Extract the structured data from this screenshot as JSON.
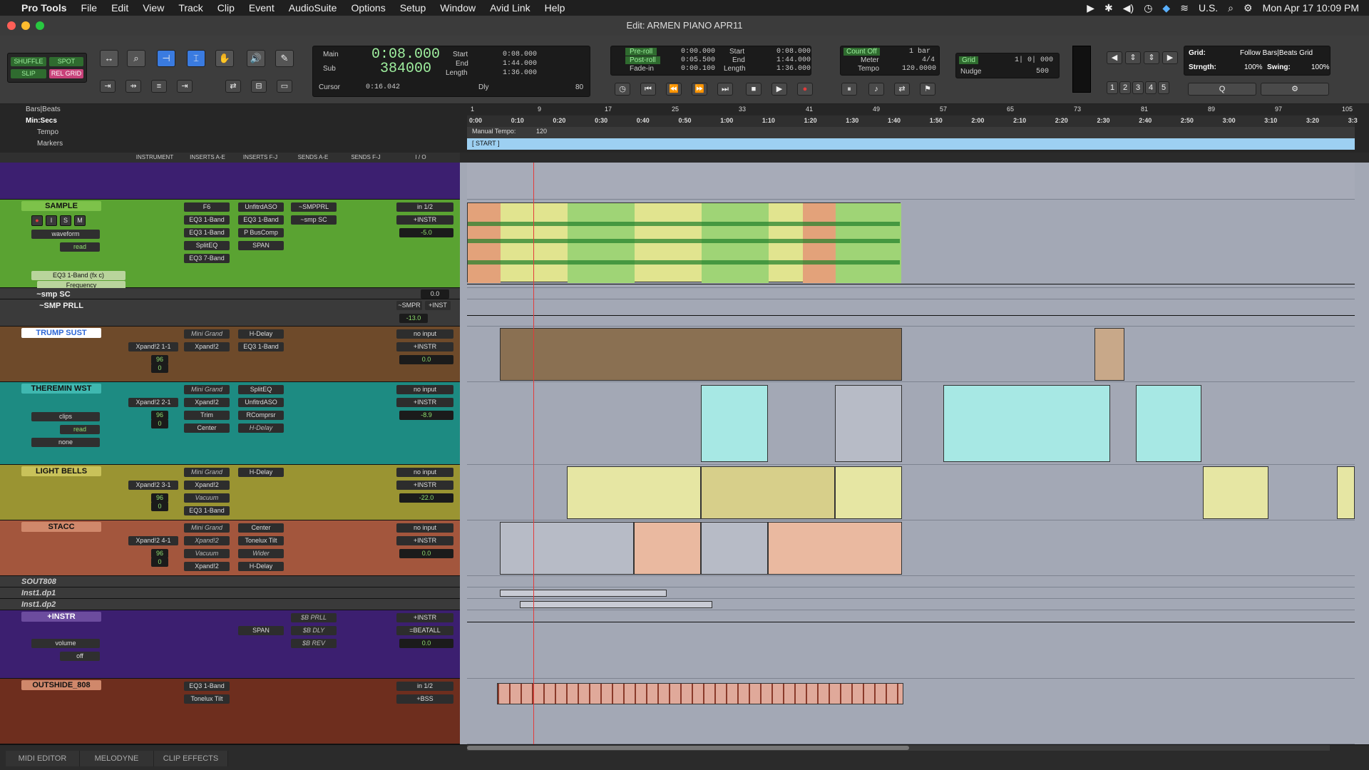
{
  "menubar": {
    "app": "Pro Tools",
    "items": [
      "File",
      "Edit",
      "View",
      "Track",
      "Clip",
      "Event",
      "AudioSuite",
      "Options",
      "Setup",
      "Window",
      "Avid Link",
      "Help"
    ],
    "input_source": "U.S.",
    "datetime": "Mon Apr 17  10:09 PM"
  },
  "window": {
    "title": "Edit: ARMEN PIANO APR11"
  },
  "modes": {
    "shuffle": "SHUFFLE",
    "spot": "SPOT",
    "slip": "SLIP",
    "relgrid": "REL GRID"
  },
  "counters": {
    "main_label": "Main",
    "main_value": "0:08.000",
    "sub_label": "Sub",
    "sub_value": "384000",
    "start_label": "Start",
    "start_value": "0:08.000",
    "end_label": "End",
    "end_value": "1:44.000",
    "length_label": "Length",
    "length_value": "1:36.000",
    "cursor_label": "Cursor",
    "cursor_value": "0:16.042",
    "dly": "Dly",
    "dly_value": "80"
  },
  "transport": {
    "preroll_label": "Pre-roll",
    "preroll_value": "0:00.000",
    "postroll_label": "Post-roll",
    "postroll_value": "0:05.500",
    "fadein_label": "Fade-in",
    "fadein_value": "0:00.100",
    "start_label": "Start",
    "start_value": "0:08.000",
    "end_label": "End",
    "end_value": "1:44.000",
    "length_label": "Length",
    "length_value": "1:36.000"
  },
  "midi": {
    "countoff": "Count Off",
    "countoff_value": "1 bar",
    "meter_label": "Meter",
    "meter_value": "4/4",
    "tempo_label": "Tempo",
    "tempo_value": "120.0000"
  },
  "grid": {
    "grid_label": "Grid",
    "grid_value": "1| 0| 000",
    "nudge_label": "Nudge",
    "nudge_value": "500",
    "grid2_label": "Grid:",
    "grid2_value": "Follow Bars|Beats Grid",
    "strength_label": "Strngth:",
    "strength_value": "100%",
    "swing_label": "Swing:",
    "swing_value": "100%"
  },
  "zoom_presets": [
    "1",
    "2",
    "3",
    "4",
    "5"
  ],
  "rulers": {
    "barsbeats": "Bars|Beats",
    "minsecs": "Min:Secs",
    "tempo": "Tempo",
    "markers": "Markers",
    "manual_tempo": "Manual Tempo:",
    "tempo_val": "120",
    "start_marker": "[ START ]",
    "bar_ticks": [
      "1",
      "9",
      "17",
      "25",
      "33",
      "41",
      "49",
      "57",
      "65",
      "73",
      "81",
      "89",
      "97",
      "105"
    ],
    "sec_ticks": [
      "0:00",
      "0:10",
      "0:20",
      "0:30",
      "0:40",
      "0:50",
      "1:00",
      "1:10",
      "1:20",
      "1:30",
      "1:40",
      "1:50",
      "2:00",
      "2:10",
      "2:20",
      "2:30",
      "2:40",
      "2:50",
      "3:00",
      "3:10",
      "3:20",
      "3:3"
    ]
  },
  "columns": [
    "INSTRUMENT",
    "INSERTS A-E",
    "INSERTS F-J",
    "SENDS A-E",
    "SENDS F-J",
    "I / O"
  ],
  "tracks": [
    {
      "name": "SAMPLE",
      "color": "#7dc24a",
      "view": "waveform",
      "auto": "read",
      "in": "in 1/2",
      "out": "+INSTR",
      "vol": "-5.0",
      "ins": [
        "F6",
        "EQ3 1-Band",
        "EQ3 1-Band",
        "SplitEQ",
        "EQ3 7-Band"
      ],
      "ins2": [
        "UnfitrdASO",
        "EQ3 1-Band",
        "P BusComp",
        "SPAN",
        ""
      ],
      "sends": [
        "~SMPPRL",
        "~smp SC",
        "",
        "",
        ""
      ],
      "lane": "EQ3 1-Band (fx c)",
      "param": "Frequency"
    },
    {
      "name": "~smp SC",
      "color": "#555",
      "vol": "0.0"
    },
    {
      "name": "~SMP PRLL",
      "color": "#555",
      "in": "~SMPR",
      "out": "+INST",
      "vol": "-13.0"
    },
    {
      "name": "TRUMP SUST",
      "color": "#b88a5c",
      "inst": "Xpand!2 1-1",
      "ins": [
        "Mini Grand",
        "Xpand!2",
        "",
        "",
        ""
      ],
      "ins2": [
        "H-Delay",
        "EQ3 1-Band",
        "",
        "",
        ""
      ],
      "in": "no input",
      "out": "+INSTR",
      "vol": "0.0",
      "mvol": "96",
      "pan": "0"
    },
    {
      "name": "THEREMIN WST",
      "color": "#3fb8b0",
      "inst": "Xpand!2 2-1",
      "ins": [
        "Mini Grand",
        "Xpand!2",
        "Trim",
        "Center",
        ""
      ],
      "ins2": [
        "SplitEQ",
        "UnfitrdASO",
        "RComprsr",
        "H-Delay",
        ""
      ],
      "in": "no input",
      "out": "+INSTR",
      "vol": "-8.9",
      "mvol": "96",
      "pan": "0",
      "view": "clips",
      "auto": "read",
      "extra": "none"
    },
    {
      "name": "LIGHT BELLS",
      "color": "#c9c25a",
      "inst": "Xpand!2 3-1",
      "ins": [
        "Mini Grand",
        "Xpand!2",
        "Vacuum",
        "EQ3 1-Band",
        ""
      ],
      "ins2": [
        "H-Delay",
        "",
        "",
        "",
        ""
      ],
      "in": "no input",
      "out": "+INSTR",
      "vol": "-22.0",
      "mvol": "96",
      "pan": "0"
    },
    {
      "name": "STACC",
      "color": "#d0886b",
      "inst": "Xpand!2 4-1",
      "ins": [
        "Mini Grand",
        "Xpand!2",
        "Vacuum",
        "Xpand!2",
        ""
      ],
      "ins2": [
        "Center",
        "Tonelux Tilt",
        "Wider",
        "H-Delay",
        ""
      ],
      "in": "no input",
      "out": "+INSTR",
      "vol": "0.0",
      "mvol": "96",
      "pan": "0"
    },
    {
      "name": "SOUT808",
      "color": "#555"
    },
    {
      "name": "Inst1.dp1",
      "color": "#555"
    },
    {
      "name": "Inst1.dp2",
      "color": "#555"
    },
    {
      "name": "+INSTR",
      "color": "#6c4c9e",
      "ins2": [
        "",
        "SPAN",
        "",
        "",
        ""
      ],
      "sends": [
        "$B PRLL",
        "$B DLY",
        "$B REV",
        "",
        ""
      ],
      "in": "+INSTR",
      "out": "=BEATALL",
      "vol": "0.0",
      "view": "volume",
      "auto": "off"
    },
    {
      "name": "OUTSHIDE_808",
      "color": "#d0886b",
      "ins": [
        "EQ3 1-Band",
        "Tonelux Tilt"
      ],
      "in": "in 1/2",
      "out": "+BSS"
    }
  ],
  "bottom_tabs": [
    "MIDI EDITOR",
    "MELODYNE",
    "CLIP EFFECTS"
  ],
  "colors": {
    "accent": "#3a7be0",
    "record": "#e23b3b",
    "lcd": "#7fd27f"
  }
}
